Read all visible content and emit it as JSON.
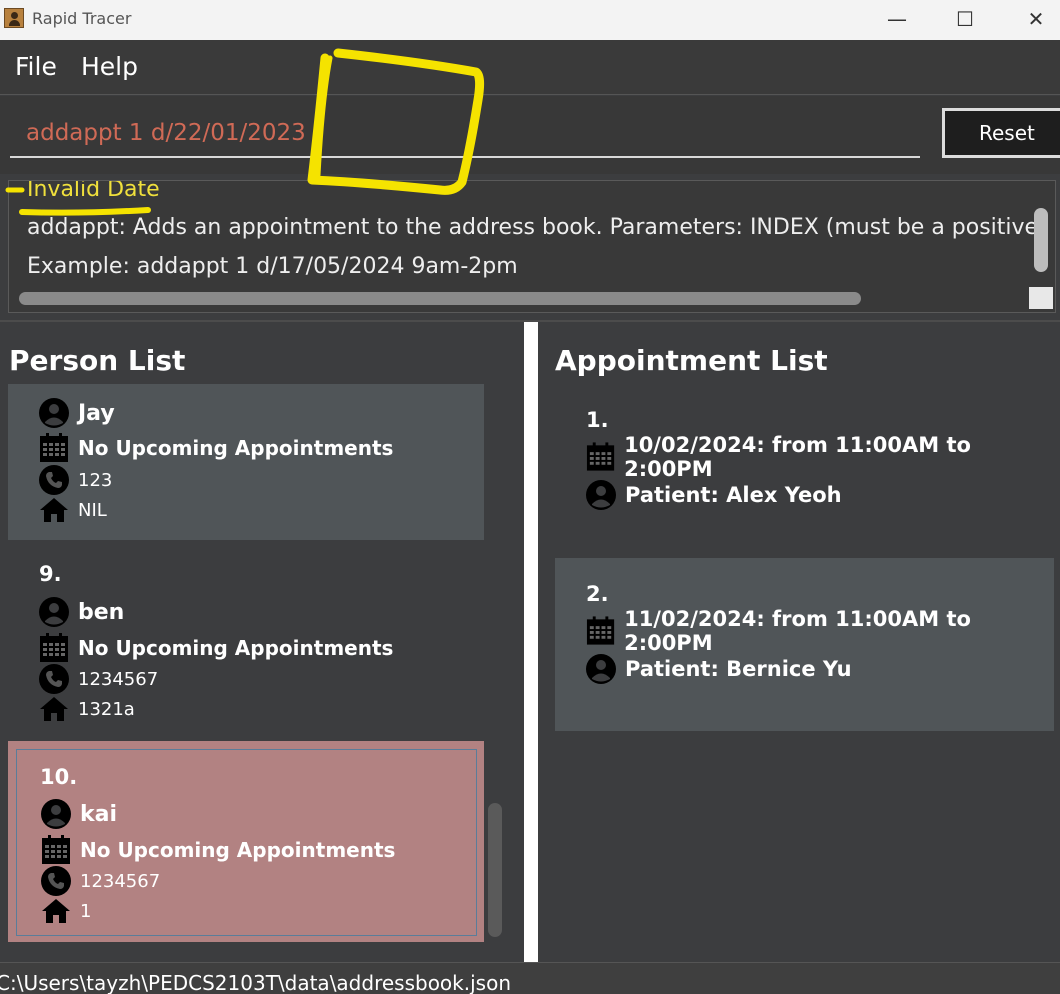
{
  "window": {
    "title": "Rapid Tracer",
    "minimize_glyph": "—",
    "maximize_glyph": "☐",
    "close_glyph": "✕"
  },
  "menu": {
    "file": "File",
    "help": "Help"
  },
  "command": {
    "value": "addappt 1 d/22/01/2023",
    "reset_label": "Reset"
  },
  "result": {
    "error": "Invalid Date",
    "usage": "addappt: Adds an appointment to the address book. Parameters: INDEX (must be a positive",
    "example": "Example: addappt 1 d/17/05/2024 9am-2pm"
  },
  "person_list": {
    "title": "Person List",
    "persons": [
      {
        "index": "",
        "name": "Jay",
        "appointment": "No Upcoming Appointments",
        "phone": "123",
        "address": "NIL"
      },
      {
        "index": "9.",
        "name": "ben",
        "appointment": "No Upcoming Appointments",
        "phone": "1234567",
        "address": "1321a"
      },
      {
        "index": "10.",
        "name": "kai",
        "appointment": "No Upcoming Appointments",
        "phone": "1234567",
        "address": "1"
      }
    ]
  },
  "appointment_list": {
    "title": "Appointment List",
    "appointments": [
      {
        "index": "1.",
        "time": "10/02/2024: from 11:00AM to 2:00PM",
        "patient": "Patient: Alex Yeoh"
      },
      {
        "index": "2.",
        "time": "11/02/2024: from 11:00AM to 2:00PM",
        "patient": "Patient: Bernice Yu"
      }
    ]
  },
  "status": {
    "path": "C:\\Users\\tayzh\\PEDCS2103T\\data\\addressbook.json"
  },
  "colors": {
    "background": "#3c3d3f",
    "card_dark": "#3c3d3f",
    "card_light": "#505558",
    "card_selected": "#b28282",
    "error_text": "#f0e03c",
    "command_text": "#d06a56",
    "annotation": "#f5e300"
  },
  "icons": {
    "person": "person-icon",
    "calendar": "calendar-icon",
    "phone": "phone-icon",
    "home": "home-icon"
  }
}
